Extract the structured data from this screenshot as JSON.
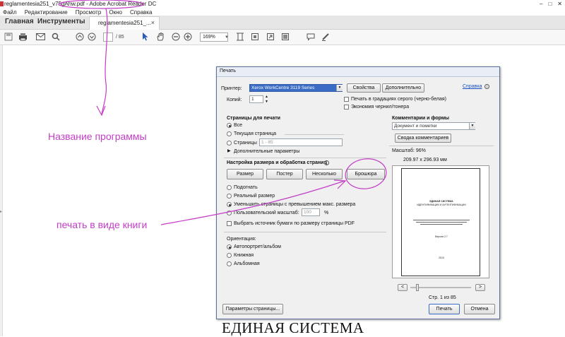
{
  "window": {
    "title": "reglamentesia251_v75gAhw.pdf - Adobe Acrobat Reader DC",
    "controls": [
      "–",
      "□",
      "✕"
    ]
  },
  "menu": [
    "Файл",
    "Редактирование",
    "Просмотр",
    "Окно",
    "Справка"
  ],
  "tabs": {
    "home": "Главная",
    "tools": "Инструменты",
    "document": "reglamentesia251_...",
    "close": "×"
  },
  "toolbar": {
    "page_total": "/ 85",
    "zoom": "169%"
  },
  "dialog": {
    "title": "Печать",
    "printer_label": "Принтер:",
    "printer_value": "Xerox WorkCentre 3119 Series",
    "properties_button": "Свойства",
    "advanced_button": "Дополнительно",
    "help_link": "Справка",
    "copies_label": "Копий:",
    "copies_value": "1",
    "grayscale_label": "Печать в градациях серого (черно-белая)",
    "save_ink_label": "Экономия чернил/тонера",
    "pages_section": "Страницы для печати",
    "pages_all": "Все",
    "pages_current": "Текущая страница",
    "pages_range_label": "Страницы",
    "pages_range_value": "1 - 85",
    "more_options": "Дополнительные параметры",
    "sizing_section": "Настройка размера и обработка страниц",
    "size_buttons": [
      "Размер",
      "Постер",
      "Несколько",
      "Брошюра"
    ],
    "fit_label": "Подогнать",
    "actual_size_label": "Реальный размер",
    "shrink_label": "Уменьшить страницы с превышением макс. размера",
    "custom_scale_label": "Пользовательский масштаб:",
    "custom_scale_value": "100",
    "custom_scale_unit": "%",
    "paper_source_label": "Выбрать источник бумаги по размеру страницы PDF",
    "orientation_section": "Ориентация:",
    "orient_auto": "Автопортрет/альбом",
    "orient_portrait": "Книжная",
    "orient_landscape": "Альбомная",
    "comments_section": "Комментарии и формы",
    "comments_value": "Документ и пометки",
    "summary_button": "Сводка комментариев",
    "scale_text": "Масштаб: 96%",
    "page_dims": "209.97 x 296.93 мм",
    "preview_lines": [
      "ЕДИНАЯ СИСТЕМА",
      "ИДЕНТИФИКАЦИИ И АУТЕНТИФИКАЦИИ"
    ],
    "preview_version": "Версия 2.7",
    "preview_year": "2013",
    "slider_prev": "<",
    "slider_next": ">",
    "page_counter": "Стр. 1 из 85",
    "page_setup_button": "Параметры страницы...",
    "print_button": "Печать",
    "cancel_button": "Отмена"
  },
  "page_heading": "ЕДИНАЯ СИСТЕМА",
  "annotations": {
    "program_name": "Название программы",
    "booklet_print": "печать в виде книги",
    "color": "#c33dc7"
  }
}
